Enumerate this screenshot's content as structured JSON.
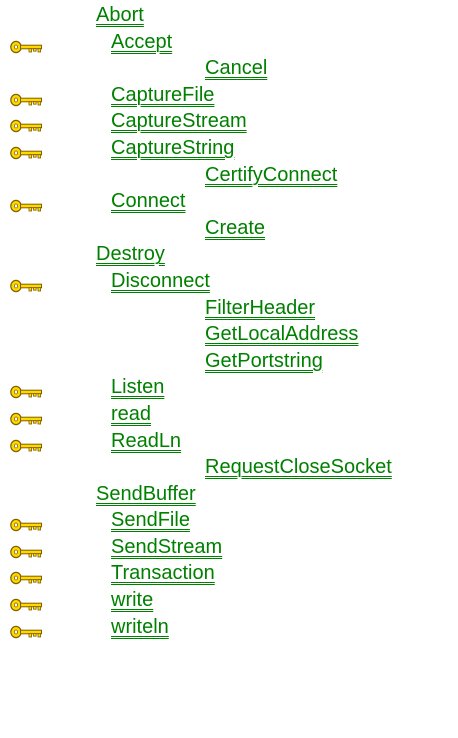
{
  "methods": [
    {
      "label": "Abort",
      "indent": 0,
      "icon": null
    },
    {
      "label": "Accept",
      "indent": 1,
      "icon": "key-icon"
    },
    {
      "label": "Cancel",
      "indent": 2,
      "icon": null
    },
    {
      "label": "CaptureFile",
      "indent": 1,
      "icon": "key-icon"
    },
    {
      "label": "CaptureStream",
      "indent": 1,
      "icon": "key-icon"
    },
    {
      "label": "CaptureString",
      "indent": 1,
      "icon": "key-icon"
    },
    {
      "label": "CertifyConnect",
      "indent": 2,
      "icon": null
    },
    {
      "label": "Connect",
      "indent": 1,
      "icon": "key-icon"
    },
    {
      "label": "Create",
      "indent": 2,
      "icon": null
    },
    {
      "label": "Destroy",
      "indent": 0,
      "icon": null
    },
    {
      "label": "Disconnect",
      "indent": 1,
      "icon": "key-icon"
    },
    {
      "label": "FilterHeader",
      "indent": 2,
      "icon": null
    },
    {
      "label": "GetLocalAddress",
      "indent": 2,
      "icon": null
    },
    {
      "label": "GetPortstring",
      "indent": 2,
      "icon": null
    },
    {
      "label": "Listen",
      "indent": 1,
      "icon": "key-icon"
    },
    {
      "label": "read",
      "indent": 1,
      "icon": "key-icon"
    },
    {
      "label": "ReadLn",
      "indent": 1,
      "icon": "key-icon"
    },
    {
      "label": "RequestCloseSocket",
      "indent": 2,
      "icon": null
    },
    {
      "label": "SendBuffer",
      "indent": 0,
      "icon": null
    },
    {
      "label": "SendFile",
      "indent": 1,
      "icon": "key-icon"
    },
    {
      "label": "SendStream",
      "indent": 1,
      "icon": "key-icon"
    },
    {
      "label": "Transaction",
      "indent": 1,
      "icon": "key-icon"
    },
    {
      "label": "write",
      "indent": 1,
      "icon": "key-icon"
    },
    {
      "label": "writeln",
      "indent": 1,
      "icon": "key-icon"
    }
  ],
  "colors": {
    "link": "#008000",
    "key_gold": "#ffd800",
    "key_outline": "#806000"
  }
}
